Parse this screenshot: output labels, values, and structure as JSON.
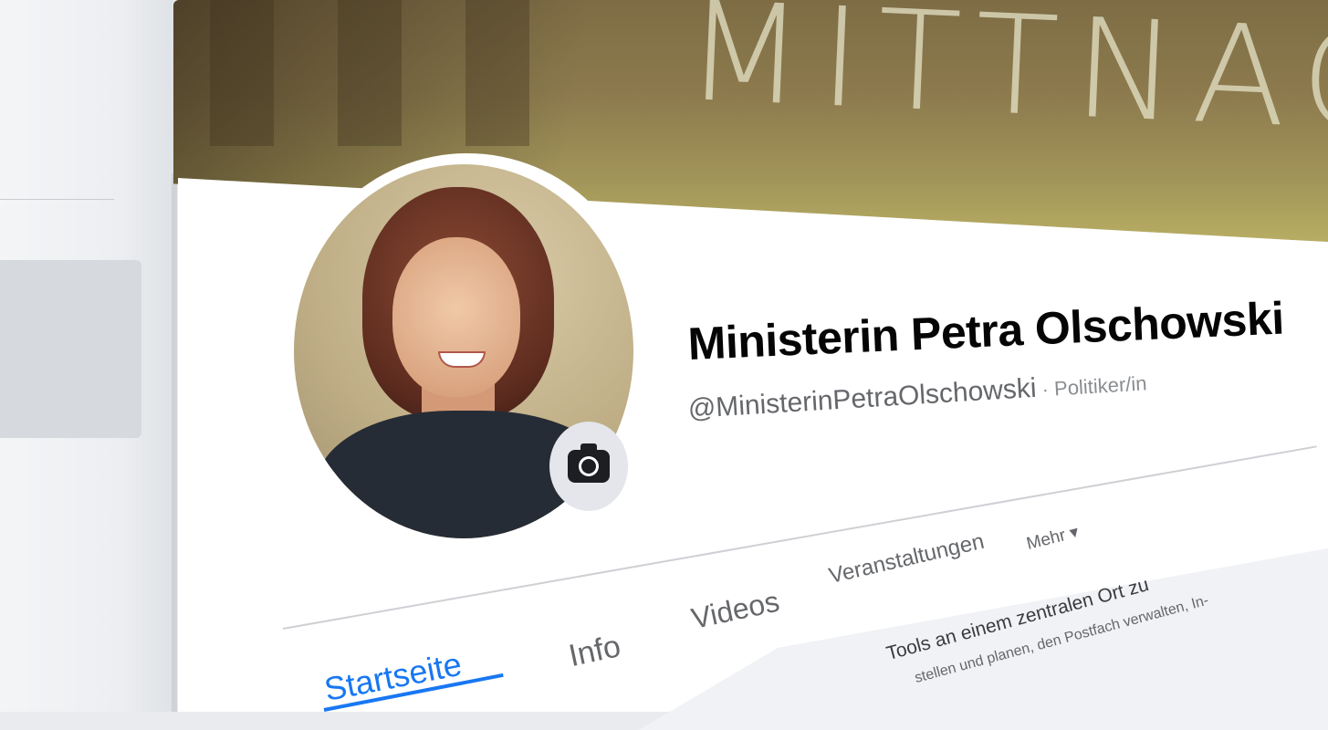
{
  "cover": {
    "text": "MITTNACHTE"
  },
  "profile": {
    "name": "Ministerin Petra Olschowski",
    "handle": "@MinisterinPetraOlschowski",
    "category": " · Politiker/in"
  },
  "tabs": [
    {
      "label": "Startseite",
      "active": true
    },
    {
      "label": "Info"
    },
    {
      "label": "Videos"
    },
    {
      "label": "Veranstaltungen"
    },
    {
      "label": "Mehr ▾"
    }
  ],
  "content": {
    "line1": "Tools an einem zentralen Ort zu",
    "line2": "stellen und planen, den Postfach verwalten, In-"
  },
  "colors": {
    "accent": "#1877f2",
    "text": "#050505",
    "muted": "#65676b"
  },
  "icons": {
    "camera": "camera-icon"
  }
}
